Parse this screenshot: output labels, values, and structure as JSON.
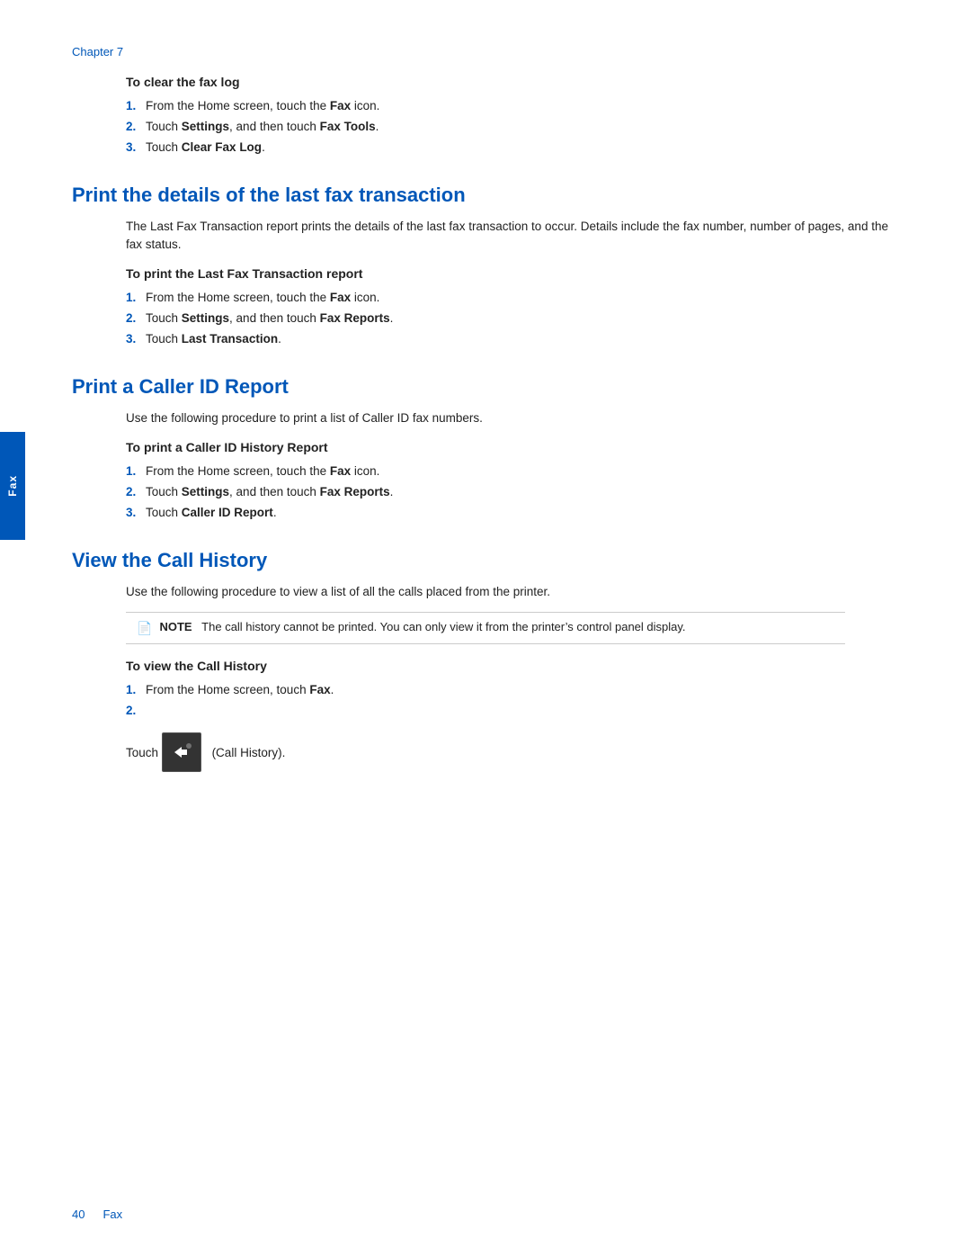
{
  "chapter": {
    "label": "Chapter 7"
  },
  "clear_fax_log": {
    "heading": "To clear the fax log",
    "steps": [
      {
        "num": "1.",
        "text_parts": [
          {
            "text": "From the Home screen, touch the ",
            "bold": false
          },
          {
            "text": "Fax",
            "bold": true
          },
          {
            "text": " icon.",
            "bold": false
          }
        ]
      },
      {
        "num": "2.",
        "text_parts": [
          {
            "text": "Touch ",
            "bold": false
          },
          {
            "text": "Settings",
            "bold": true
          },
          {
            "text": ", and then touch ",
            "bold": false
          },
          {
            "text": "Fax Tools",
            "bold": true
          },
          {
            "text": ".",
            "bold": false
          }
        ]
      },
      {
        "num": "3.",
        "text_parts": [
          {
            "text": "Touch ",
            "bold": false
          },
          {
            "text": "Clear Fax Log",
            "bold": true
          },
          {
            "text": ".",
            "bold": false
          }
        ]
      }
    ]
  },
  "section_last_fax": {
    "heading": "Print the details of the last fax transaction",
    "body": "The Last Fax Transaction report prints the details of the last fax transaction to occur. Details include the fax number, number of pages, and the fax status.",
    "subheading": "To print the Last Fax Transaction report",
    "steps": [
      {
        "num": "1.",
        "text_parts": [
          {
            "text": "From the Home screen, touch the ",
            "bold": false
          },
          {
            "text": "Fax",
            "bold": true
          },
          {
            "text": " icon.",
            "bold": false
          }
        ]
      },
      {
        "num": "2.",
        "text_parts": [
          {
            "text": "Touch ",
            "bold": false
          },
          {
            "text": "Settings",
            "bold": true
          },
          {
            "text": ", and then touch ",
            "bold": false
          },
          {
            "text": "Fax Reports",
            "bold": true
          },
          {
            "text": ".",
            "bold": false
          }
        ]
      },
      {
        "num": "3.",
        "text_parts": [
          {
            "text": "Touch ",
            "bold": false
          },
          {
            "text": "Last Transaction",
            "bold": true
          },
          {
            "text": ".",
            "bold": false
          }
        ]
      }
    ]
  },
  "section_caller_id": {
    "heading": "Print a Caller ID Report",
    "body": "Use the following procedure to print a list of Caller ID fax numbers.",
    "subheading": "To print a Caller ID History Report",
    "steps": [
      {
        "num": "1.",
        "text_parts": [
          {
            "text": "From the Home screen, touch the ",
            "bold": false
          },
          {
            "text": "Fax",
            "bold": true
          },
          {
            "text": " icon.",
            "bold": false
          }
        ]
      },
      {
        "num": "2.",
        "text_parts": [
          {
            "text": "Touch ",
            "bold": false
          },
          {
            "text": "Settings",
            "bold": true
          },
          {
            "text": ", and then touch ",
            "bold": false
          },
          {
            "text": "Fax Reports",
            "bold": true
          },
          {
            "text": ".",
            "bold": false
          }
        ]
      },
      {
        "num": "3.",
        "text_parts": [
          {
            "text": "Touch ",
            "bold": false
          },
          {
            "text": "Caller ID Report",
            "bold": true
          },
          {
            "text": ".",
            "bold": false
          }
        ]
      }
    ]
  },
  "section_call_history": {
    "heading": "View the Call History",
    "body": "Use the following procedure to view a list of all the calls placed from the printer.",
    "note_label": "NOTE",
    "note_text": "The call history cannot be printed. You can only view it from the printer’s control panel display.",
    "subheading": "To view the Call History",
    "steps_before_icon": [
      {
        "num": "1.",
        "text_parts": [
          {
            "text": "From the Home screen, touch ",
            "bold": false
          },
          {
            "text": "Fax",
            "bold": true
          },
          {
            "text": ".",
            "bold": false
          }
        ]
      },
      {
        "num": "2.",
        "text_parts": []
      }
    ],
    "touch_text": "Touch",
    "touch_suffix": "(Call History)."
  },
  "footer": {
    "page_num": "40",
    "section": "Fax"
  },
  "side_tab": {
    "label": "Fax"
  }
}
